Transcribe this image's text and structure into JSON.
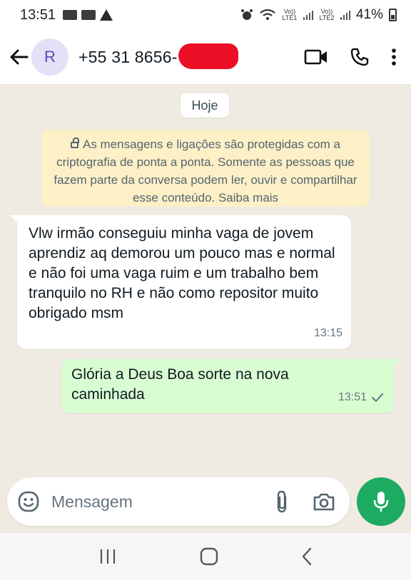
{
  "status_bar": {
    "time": "13:51",
    "volte1": "Vo)) LTE1",
    "volte2": "Vo)) LTE2",
    "battery": "41%"
  },
  "header": {
    "avatar_initial": "R",
    "contact_number": "+55 31 8656-"
  },
  "chat": {
    "date_chip": "Hoje",
    "encryption_notice": "As mensagens e ligações são protegidas com a criptografia de ponta a ponta. Somente as pessoas que fazem parte da conversa podem ler, ouvir e compartilhar esse conteúdo. Saiba mais",
    "messages": [
      {
        "direction": "incoming",
        "text": "Vlw irmão conseguiu minha vaga de jovem aprendiz aq demorou um pouco mas e normal e não foi uma vaga ruim e um trabalho bem tranquilo no RH e não como repositor muito obrigado msm",
        "time": "13:15"
      },
      {
        "direction": "outgoing",
        "text": "Glória a Deus Boa sorte na nova caminhada",
        "time": "13:51",
        "status_icon": "single-check-icon"
      }
    ]
  },
  "composer": {
    "placeholder": "Mensagem"
  },
  "colors": {
    "outgoing_bubble": "#d9fdd3",
    "encryption_bubble": "#fdf0c7",
    "mic_button": "#1daa61",
    "chat_background": "#efeae2"
  }
}
